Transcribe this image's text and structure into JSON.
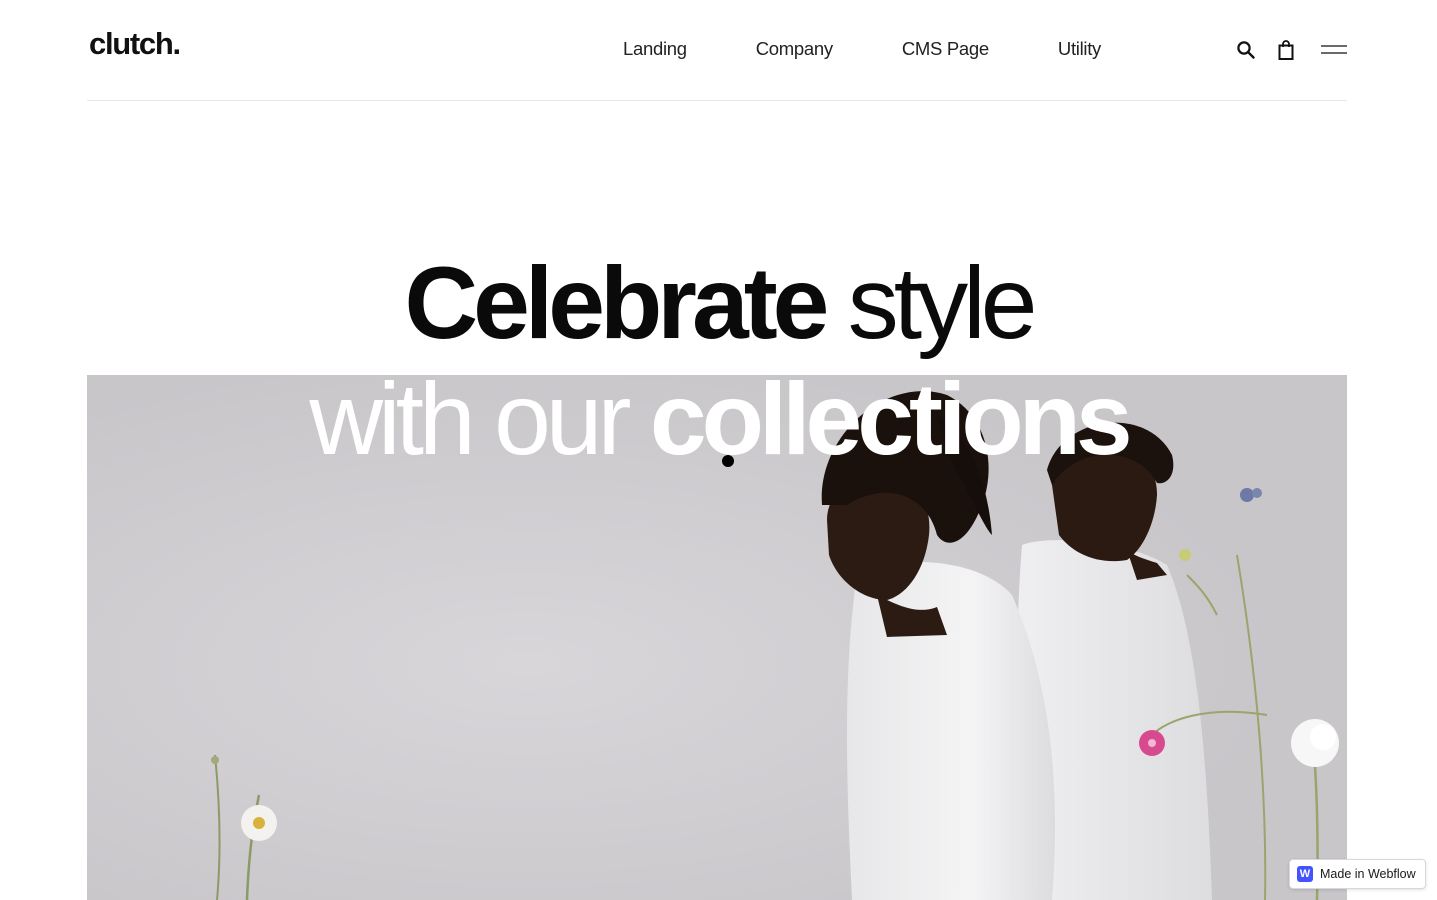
{
  "brand": {
    "logo_text": "clutch."
  },
  "nav": {
    "items": [
      {
        "label": "Landing"
      },
      {
        "label": "Company"
      },
      {
        "label": "CMS Page"
      },
      {
        "label": "Utility"
      }
    ]
  },
  "header_icons": {
    "search": "search-icon",
    "bag": "shopping-bag-icon",
    "menu": "hamburger-menu-icon"
  },
  "hero": {
    "line1_bold": "Celebrate",
    "line1_thin": " style",
    "line2_thin": "with our ",
    "line2_bold": "collections"
  },
  "badge": {
    "label": "Made in Webflow",
    "logo_letter": "W"
  },
  "colors": {
    "text": "#0b0b0b",
    "divider": "#e6e6e6",
    "hero_bg": "#cfcdd0",
    "webflow_blue": "#4353ff"
  }
}
